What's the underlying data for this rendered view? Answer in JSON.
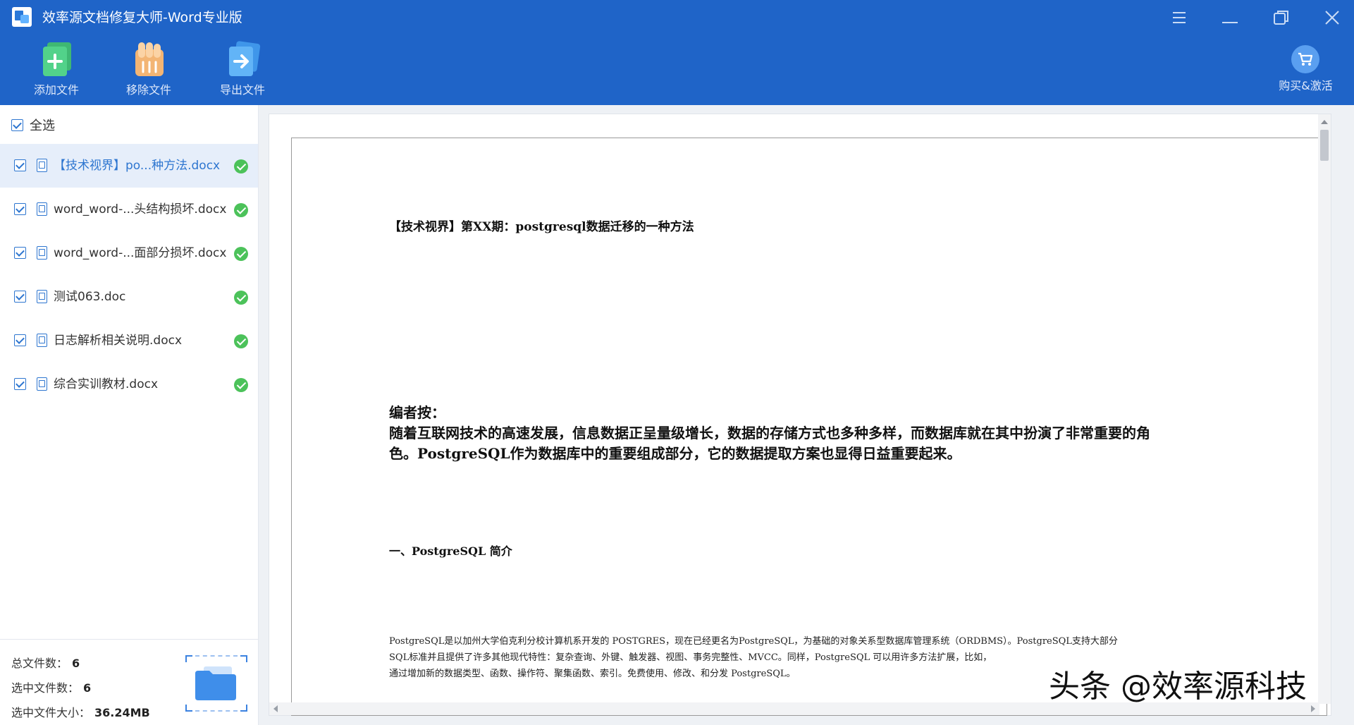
{
  "app": {
    "title": "效率源文档修复大师-Word专业版",
    "accent_color": "#1f64c8"
  },
  "window_controls": [
    {
      "name": "menu-icon"
    },
    {
      "name": "minimize-icon"
    },
    {
      "name": "restore-icon"
    },
    {
      "name": "close-icon"
    }
  ],
  "toolbar": {
    "add_label": "添加文件",
    "remove_label": "移除文件",
    "export_label": "导出文件",
    "buy_label": "购买&激活"
  },
  "sidebar": {
    "select_all_label": "全选",
    "files": [
      {
        "name": "【技术视界】po...种方法.docx",
        "checked": true,
        "status": "ok",
        "selected": true
      },
      {
        "name": "word_word-...头结构损坏.docx",
        "checked": true,
        "status": "ok",
        "selected": false
      },
      {
        "name": "word_word-...面部分损坏.docx",
        "checked": true,
        "status": "ok",
        "selected": false
      },
      {
        "name": "测试063.doc",
        "checked": true,
        "status": "ok",
        "selected": false
      },
      {
        "name": "日志解析相关说明.docx",
        "checked": true,
        "status": "ok",
        "selected": false
      },
      {
        "name": "综合实训教材.docx",
        "checked": true,
        "status": "ok",
        "selected": false
      }
    ],
    "stats": {
      "total_label": "总文件数：",
      "total_value": "6",
      "selected_label": "选中文件数：",
      "selected_value": "6",
      "size_label": "选中文件大小：",
      "size_value": "36.24MB"
    }
  },
  "preview": {
    "doc_title": "【技术视界】第XX期：postgresql数据迁移的一种方法",
    "editor_heading": "编者按：",
    "editor_lines": [
      "随着互联网技术的高速发展，信息数据正呈量级增长，数据的存储方式也多种多样，而数据库就在其中扮演了非常重要的角",
      "色。PostgreSQL作为数据库中的重要组成部分，它的数据提取方案也显得日益重要起来。"
    ],
    "section_title": "一、PostgreSQL 简介",
    "body_lines": [
      "PostgreSQL是以加州大学伯克利分校计算机系开发的 POSTGRES，现在已经更名为PostgreSQL，为基础的对象关系型数据库管理系统（ORDBMS）。PostgreSQL支持大部分",
      "SQL标准并且提供了许多其他现代特性：复杂查询、外键、触发器、视图、事务完整性、MVCC。同样，PostgreSQL 可以用许多方法扩展，比如，",
      "通过增加新的数据类型、函数、操作符、聚集函数、索引。免费使用、修改、和分发 PostgreSQL。"
    ]
  },
  "watermark": "头条 @效率源科技"
}
